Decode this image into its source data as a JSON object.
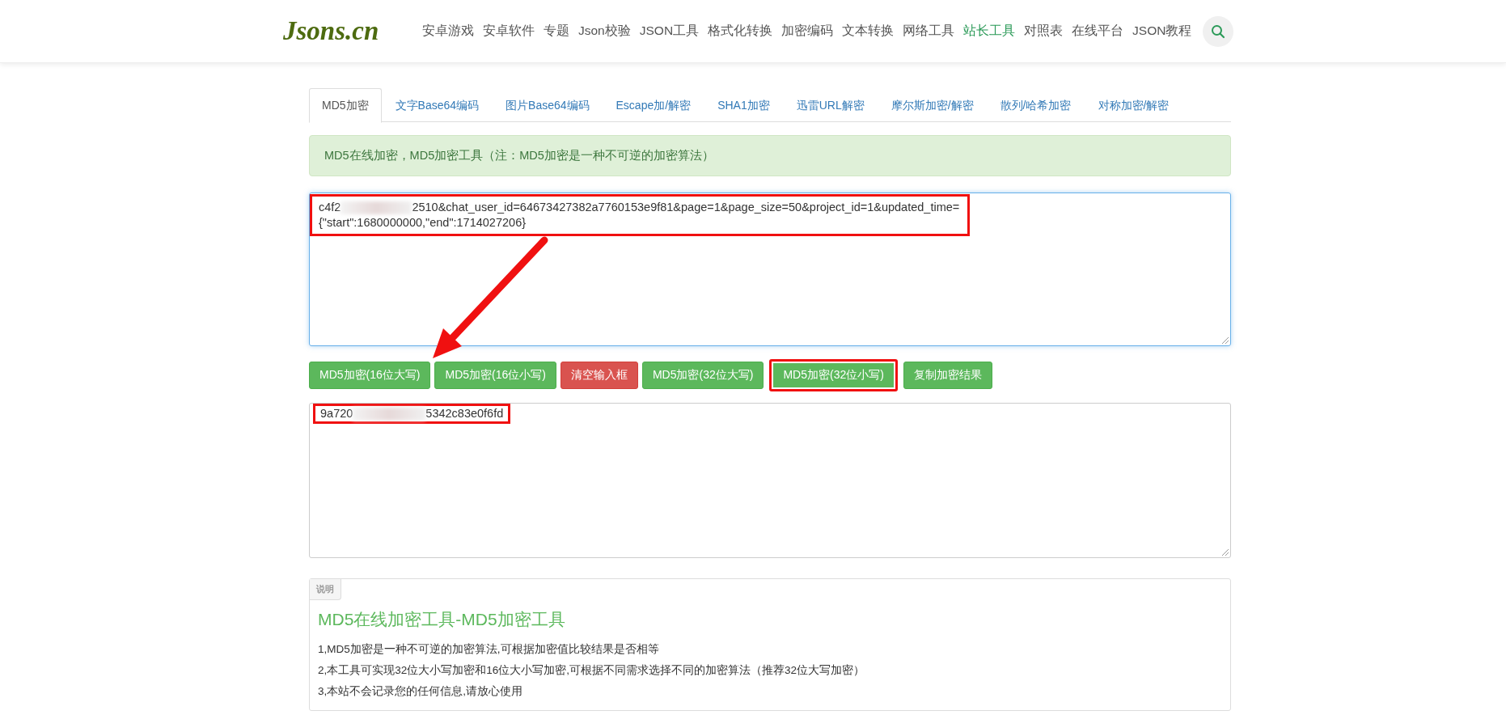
{
  "header": {
    "logo": "Jsons.cn",
    "nav": [
      {
        "label": "安卓游戏",
        "selected": false
      },
      {
        "label": "安卓软件",
        "selected": false
      },
      {
        "label": "专题",
        "selected": false
      },
      {
        "label": "Json校验",
        "selected": false
      },
      {
        "label": "JSON工具",
        "selected": false
      },
      {
        "label": "格式化转换",
        "selected": false
      },
      {
        "label": "加密编码",
        "selected": false
      },
      {
        "label": "文本转换",
        "selected": false
      },
      {
        "label": "网络工具",
        "selected": false
      },
      {
        "label": "站长工具",
        "selected": true
      },
      {
        "label": "对照表",
        "selected": false
      },
      {
        "label": "在线平台",
        "selected": false
      },
      {
        "label": "JSON教程",
        "selected": false
      }
    ]
  },
  "tabs": [
    {
      "label": "MD5加密",
      "selected": true
    },
    {
      "label": "文字Base64编码",
      "selected": false
    },
    {
      "label": "图片Base64编码",
      "selected": false
    },
    {
      "label": "Escape加/解密",
      "selected": false
    },
    {
      "label": "SHA1加密",
      "selected": false
    },
    {
      "label": "迅雷URL解密",
      "selected": false
    },
    {
      "label": "摩尔斯加密/解密",
      "selected": false
    },
    {
      "label": "散列/哈希加密",
      "selected": false
    },
    {
      "label": "对称加密/解密",
      "selected": false
    }
  ],
  "alert": "MD5在线加密，MD5加密工具（注：MD5加密是一种不可逆的加密算法）",
  "input": {
    "highlighted": true,
    "lines": [
      [
        {
          "kind": "text",
          "text": "c4f2"
        },
        {
          "kind": "redacted"
        },
        {
          "kind": "text",
          "text": "2510&chat_user_id=64673427382a7760153e9f81&page=1&page_size=50&project_id=1&updated_time="
        }
      ],
      [
        {
          "kind": "text",
          "text": "{\"start\":1680000000,\"end\":1714027206}"
        }
      ]
    ]
  },
  "buttons": [
    {
      "label": "MD5加密(16位大写)",
      "kind": "success",
      "highlighted": false
    },
    {
      "label": "MD5加密(16位小写)",
      "kind": "success",
      "highlighted": false
    },
    {
      "label": "清空输入框",
      "kind": "danger",
      "highlighted": false
    },
    {
      "label": "MD5加密(32位大写)",
      "kind": "success",
      "highlighted": false
    },
    {
      "label": "MD5加密(32位小写)",
      "kind": "success",
      "highlighted": true
    },
    {
      "label": "复制加密结果",
      "kind": "success",
      "highlighted": false
    }
  ],
  "output": {
    "highlighted": true,
    "lines": [
      [
        {
          "kind": "text",
          "text": "9a720"
        },
        {
          "kind": "redacted"
        },
        {
          "kind": "text",
          "text": "5342c83e0f6fd"
        }
      ]
    ]
  },
  "annotation": {
    "kind": "arrow"
  },
  "explanation": {
    "tag": "说明",
    "title": "MD5在线加密工具-MD5加密工具",
    "items": [
      "1,MD5加密是一种不可逆的加密算法,可根据加密值比较结果是否相等",
      "2,本工具可实现32位大小写加密和16位大小写加密,可根据不同需求选择不同的加密算法（推荐32位大写加密）",
      "3,本站不会记录您的任何信息,请放心使用"
    ]
  }
}
